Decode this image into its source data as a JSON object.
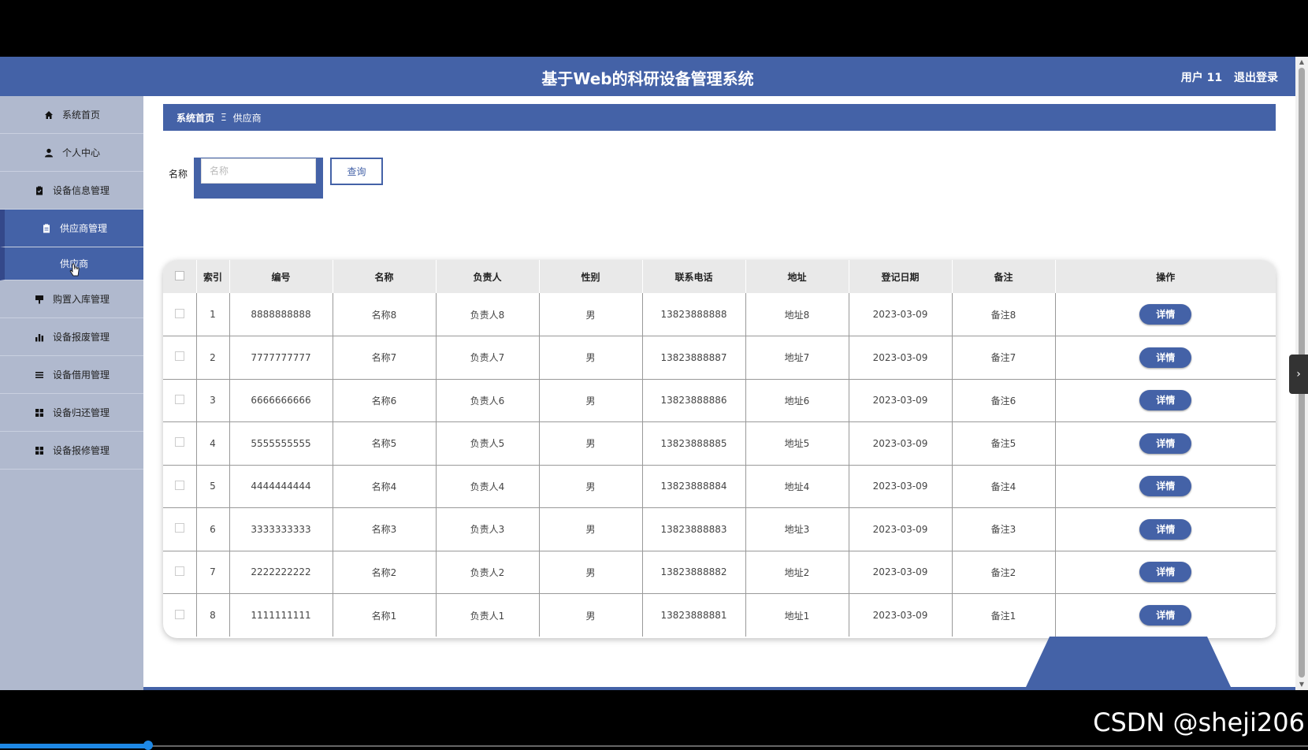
{
  "header": {
    "title": "基于Web的科研设备管理系统",
    "username": "用户 11",
    "logout": "退出登录"
  },
  "sidebar": {
    "items": [
      {
        "label": "系统首页",
        "icon": "home-icon"
      },
      {
        "label": "个人中心",
        "icon": "user-icon"
      },
      {
        "label": "设备信息管理",
        "icon": "clipboard-icon"
      },
      {
        "label": "供应商管理",
        "icon": "clipboard-icon"
      },
      {
        "label": "购置入库管理",
        "icon": "flag-icon"
      },
      {
        "label": "设备报废管理",
        "icon": "bar-chart-icon"
      },
      {
        "label": "设备借用管理",
        "icon": "list-icon"
      },
      {
        "label": "设备归还管理",
        "icon": "grid-icon"
      },
      {
        "label": "设备报修管理",
        "icon": "grid-icon"
      }
    ],
    "submenu": "供应商"
  },
  "breadcrumb": {
    "home": "系统首页",
    "sep": "Ξ",
    "current": "供应商"
  },
  "search": {
    "label": "名称",
    "placeholder": "名称",
    "button": "查询"
  },
  "table": {
    "headers": [
      "索引",
      "编号",
      "名称",
      "负责人",
      "性别",
      "联系电话",
      "地址",
      "登记日期",
      "备注",
      "操作"
    ],
    "rows": [
      {
        "index": "1",
        "code": "8888888888",
        "name": "名称8",
        "manager": "负责人8",
        "gender": "男",
        "phone": "13823888888",
        "address": "地址8",
        "date": "2023-03-09",
        "remark": "备注8",
        "action": "详情"
      },
      {
        "index": "2",
        "code": "7777777777",
        "name": "名称7",
        "manager": "负责人7",
        "gender": "男",
        "phone": "13823888887",
        "address": "地址7",
        "date": "2023-03-09",
        "remark": "备注7",
        "action": "详情"
      },
      {
        "index": "3",
        "code": "6666666666",
        "name": "名称6",
        "manager": "负责人6",
        "gender": "男",
        "phone": "13823888886",
        "address": "地址6",
        "date": "2023-03-09",
        "remark": "备注6",
        "action": "详情"
      },
      {
        "index": "4",
        "code": "5555555555",
        "name": "名称5",
        "manager": "负责人5",
        "gender": "男",
        "phone": "13823888885",
        "address": "地址5",
        "date": "2023-03-09",
        "remark": "备注5",
        "action": "详情"
      },
      {
        "index": "5",
        "code": "4444444444",
        "name": "名称4",
        "manager": "负责人4",
        "gender": "男",
        "phone": "13823888884",
        "address": "地址4",
        "date": "2023-03-09",
        "remark": "备注4",
        "action": "详情"
      },
      {
        "index": "6",
        "code": "3333333333",
        "name": "名称3",
        "manager": "负责人3",
        "gender": "男",
        "phone": "13823888883",
        "address": "地址3",
        "date": "2023-03-09",
        "remark": "备注3",
        "action": "详情"
      },
      {
        "index": "7",
        "code": "2222222222",
        "name": "名称2",
        "manager": "负责人2",
        "gender": "男",
        "phone": "13823888882",
        "address": "地址2",
        "date": "2023-03-09",
        "remark": "备注2",
        "action": "详情"
      },
      {
        "index": "8",
        "code": "1111111111",
        "name": "名称1",
        "manager": "负责人1",
        "gender": "男",
        "phone": "13823888881",
        "address": "地址1",
        "date": "2023-03-09",
        "remark": "备注1",
        "action": "详情"
      }
    ]
  },
  "watermark": "CSDN @sheji206",
  "colors": {
    "primary": "#4462a7",
    "sidebar_bg": "#b0b9ce"
  }
}
